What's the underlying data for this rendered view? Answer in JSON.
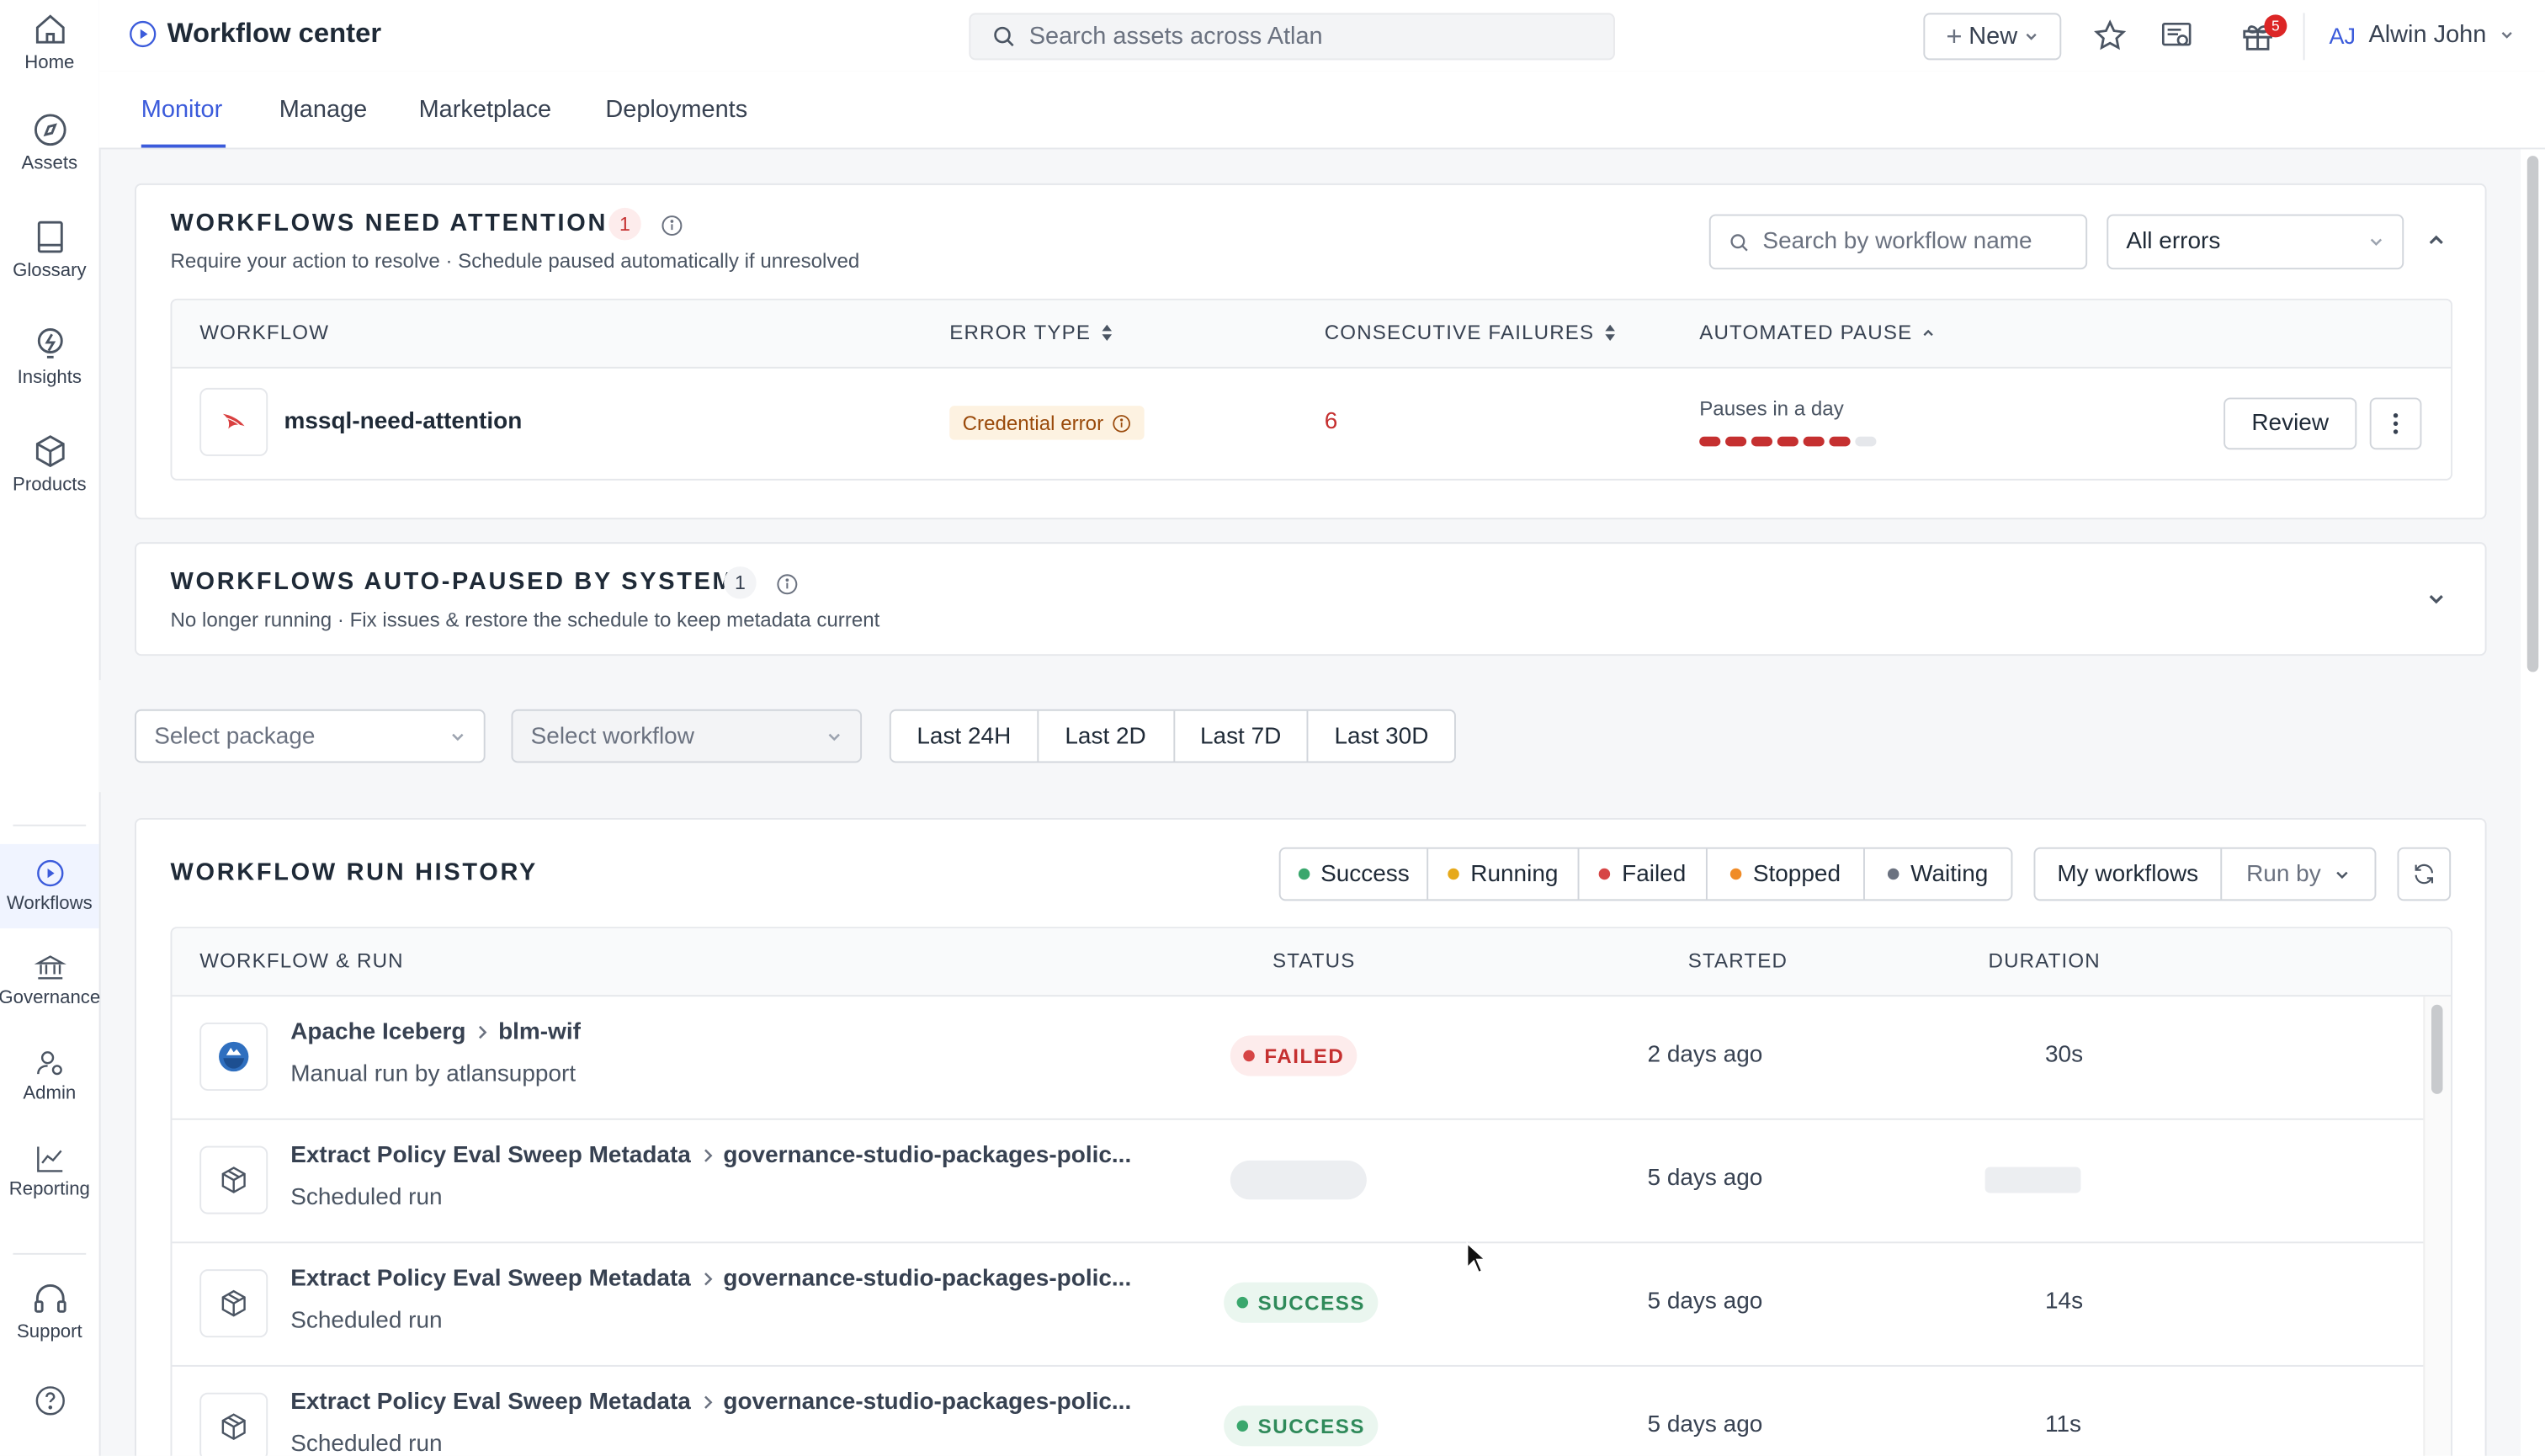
{
  "nav": {
    "top": [
      {
        "label": "Home",
        "icon": "home-icon"
      },
      {
        "label": "Assets",
        "icon": "compass-icon"
      },
      {
        "label": "Glossary",
        "icon": "book-icon"
      },
      {
        "label": "Insights",
        "icon": "lightbulb-icon"
      },
      {
        "label": "Products",
        "icon": "cube-icon"
      }
    ],
    "bottom": [
      {
        "label": "Workflows",
        "icon": "play-circle-icon",
        "active": true
      },
      {
        "label": "Governance",
        "icon": "bank-icon"
      },
      {
        "label": "Admin",
        "icon": "users-gear-icon"
      },
      {
        "label": "Reporting",
        "icon": "chart-line-icon"
      },
      {
        "label": "Support",
        "icon": "headset-icon"
      }
    ],
    "help_icon": "question-circle-icon"
  },
  "header": {
    "title": "Workflow center",
    "search_placeholder": "Search assets across Atlan",
    "new_label": "New",
    "gift_badge": "5",
    "user_initials": "AJ",
    "user_name": "Alwin John"
  },
  "tabs": [
    "Monitor",
    "Manage",
    "Marketplace",
    "Deployments"
  ],
  "attention": {
    "title": "WORKFLOWS NEED ATTENTION",
    "count": "1",
    "subtitle": "Require your action to resolve · Schedule paused automatically if unresolved",
    "search_placeholder": "Search by workflow name",
    "filter_value": "All errors",
    "columns": [
      "WORKFLOW",
      "ERROR TYPE",
      "CONSECUTIVE FAILURES",
      "AUTOMATED PAUSE"
    ],
    "row": {
      "name": "mssql-need-attention",
      "error_type": "Credential error",
      "failures": "6",
      "pause_text": "Pauses in a day",
      "pause_progress": {
        "filled": 6,
        "total": 7
      },
      "action": "Review"
    }
  },
  "autopaused": {
    "title": "WORKFLOWS AUTO-PAUSED BY SYSTEM",
    "count": "1",
    "subtitle": "No longer running · Fix issues & restore the schedule to keep metadata current"
  },
  "filters": {
    "package_placeholder": "Select package",
    "workflow_placeholder": "Select workflow",
    "ranges": [
      "Last 24H",
      "Last 2D",
      "Last 7D",
      "Last 30D"
    ]
  },
  "history": {
    "title": "WORKFLOW RUN HISTORY",
    "status_filters": [
      {
        "label": "Success",
        "color": "#3aa76d"
      },
      {
        "label": "Running",
        "color": "#e6a91a"
      },
      {
        "label": "Failed",
        "color": "#d64545"
      },
      {
        "label": "Stopped",
        "color": "#f08c28"
      },
      {
        "label": "Waiting",
        "color": "#6b7280"
      }
    ],
    "my_workflows": "My workflows",
    "run_by": "Run by",
    "columns": [
      "WORKFLOW & RUN",
      "STATUS",
      "STARTED",
      "DURATION"
    ],
    "rows": [
      {
        "package": "Apache Iceberg",
        "workflow": "blm-wif",
        "run": "Manual run by atlansupport",
        "status": "FAILED",
        "started": "2 days ago",
        "duration": "30s",
        "icon": "iceberg-icon"
      },
      {
        "package": "Extract Policy Eval Sweep Metadata",
        "workflow": "governance-studio-packages-polic...",
        "run": "Scheduled run",
        "status": "",
        "started": "5 days ago",
        "duration": "",
        "icon": "package-cube-icon"
      },
      {
        "package": "Extract Policy Eval Sweep Metadata",
        "workflow": "governance-studio-packages-polic...",
        "run": "Scheduled run",
        "status": "SUCCESS",
        "started": "5 days ago",
        "duration": "14s",
        "icon": "package-cube-icon"
      },
      {
        "package": "Extract Policy Eval Sweep Metadata",
        "workflow": "governance-studio-packages-polic...",
        "run": "Scheduled run",
        "status": "SUCCESS",
        "started": "5 days ago",
        "duration": "11s",
        "icon": "package-cube-icon"
      }
    ]
  },
  "colors": {
    "accent": "#3b5bdb",
    "failed": "#c53030",
    "success": "#2f8a5a"
  }
}
